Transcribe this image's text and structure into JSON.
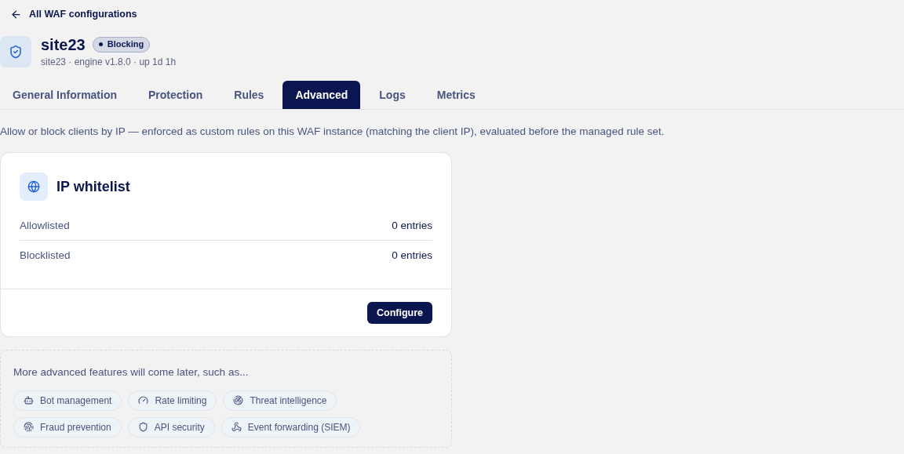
{
  "back_link": "All WAF configurations",
  "header": {
    "title": "site23",
    "status": {
      "label": "Blocking",
      "kind": "blocking"
    },
    "subtitle": "site23 · engine v1.8.0 · up 1d 1h"
  },
  "tabs": [
    {
      "label": "General Information",
      "selected": false
    },
    {
      "label": "Protection",
      "selected": false
    },
    {
      "label": "Rules",
      "selected": false
    },
    {
      "label": "Advanced",
      "selected": true
    },
    {
      "label": "Logs",
      "selected": false
    },
    {
      "label": "Metrics",
      "selected": false
    }
  ],
  "description": "Allow or block clients by IP — enforced as custom rules on this WAF instance (matching the client IP), evaluated before the managed rule set.",
  "card": {
    "title": "IP whitelist",
    "rows": [
      {
        "label": "Allowlisted",
        "value": "0 entries"
      },
      {
        "label": "Blocklisted",
        "value": "0 entries"
      }
    ],
    "button": "Configure"
  },
  "upcoming": {
    "intro": "More advanced features will come later, such as...",
    "features": [
      {
        "label": "Bot management",
        "kind": "bot"
      },
      {
        "label": "Rate limiting",
        "kind": "gauge"
      },
      {
        "label": "Threat intelligence",
        "kind": "radar"
      },
      {
        "label": "Fraud prevention",
        "kind": "fingerprint"
      },
      {
        "label": "API security",
        "kind": "shield"
      },
      {
        "label": "Event forwarding (SIEM)",
        "kind": "webhook"
      }
    ]
  }
}
